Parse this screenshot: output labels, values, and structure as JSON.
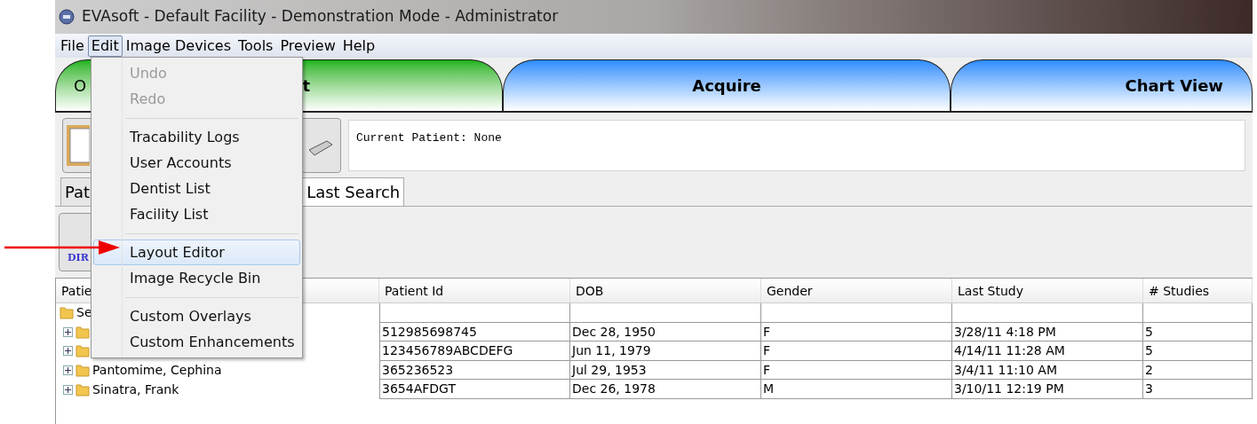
{
  "window": {
    "title": "EVAsoft - Default Facility - Demonstration Mode - Administrator"
  },
  "menu_bar": [
    {
      "label": "File",
      "selected": false
    },
    {
      "label": "Edit",
      "selected": true
    },
    {
      "label": "Image Devices",
      "selected": false
    },
    {
      "label": "Tools",
      "selected": false
    },
    {
      "label": "Preview",
      "selected": false
    },
    {
      "label": "Help",
      "selected": false
    }
  ],
  "main_tabs": [
    {
      "label_parts": [
        "O",
        "t"
      ],
      "selected": true
    },
    {
      "label_parts": [
        "Acquire"
      ],
      "selected": false
    },
    {
      "label_parts": [
        "Chart View"
      ],
      "selected": false
    }
  ],
  "current_patient": "Current Patient: None",
  "sub_tabs": [
    {
      "label": "Pat",
      "selected": false
    },
    {
      "label": "Last Search",
      "selected": true
    }
  ],
  "toolbar_icon_text": "DIR",
  "table": {
    "columns": [
      "Patie",
      "Patient Id",
      "DOB",
      "Gender",
      "Last Study",
      "# Studies"
    ],
    "rows": [
      {
        "kind": "group",
        "cells": [
          "Se",
          "",
          "",
          "",
          "",
          ""
        ]
      },
      {
        "kind": "patient",
        "cells": [
          "",
          "512985698745",
          "Dec 28, 1950",
          "F",
          "3/28/11 4:18 PM",
          "5"
        ]
      },
      {
        "kind": "patient",
        "cells": [
          "",
          "123456789ABCDEFG",
          "Jun 11, 1979",
          "F",
          "4/14/11 11:28 AM",
          "5"
        ]
      },
      {
        "kind": "patient",
        "cells": [
          "Pantomime, Cephina",
          "365236523",
          "Jul 29, 1953",
          "F",
          "3/4/11 11:10 AM",
          "2"
        ]
      },
      {
        "kind": "patient",
        "cells": [
          "Sinatra, Frank",
          "3654AFDGT",
          "Dec 26, 1978",
          "M",
          "3/10/11 12:19 PM",
          "3"
        ]
      }
    ]
  },
  "edit_menu": [
    {
      "kind": "item",
      "label": "Undo",
      "disabled": true,
      "selected": false
    },
    {
      "kind": "item",
      "label": "Redo",
      "disabled": true,
      "selected": false
    },
    {
      "kind": "separator"
    },
    {
      "kind": "item",
      "label": "Tracability Logs",
      "disabled": false,
      "selected": false
    },
    {
      "kind": "item",
      "label": "User Accounts",
      "disabled": false,
      "selected": false
    },
    {
      "kind": "item",
      "label": "Dentist List",
      "disabled": false,
      "selected": false
    },
    {
      "kind": "item",
      "label": "Facility List",
      "disabled": false,
      "selected": false
    },
    {
      "kind": "separator"
    },
    {
      "kind": "item",
      "label": "Layout Editor",
      "disabled": false,
      "selected": true
    },
    {
      "kind": "item",
      "label": "Image Recycle Bin",
      "disabled": false,
      "selected": false
    },
    {
      "kind": "separator"
    },
    {
      "kind": "item",
      "label": "Custom Overlays",
      "disabled": false,
      "selected": false
    },
    {
      "kind": "item",
      "label": "Custom Enhancements",
      "disabled": false,
      "selected": false
    }
  ]
}
